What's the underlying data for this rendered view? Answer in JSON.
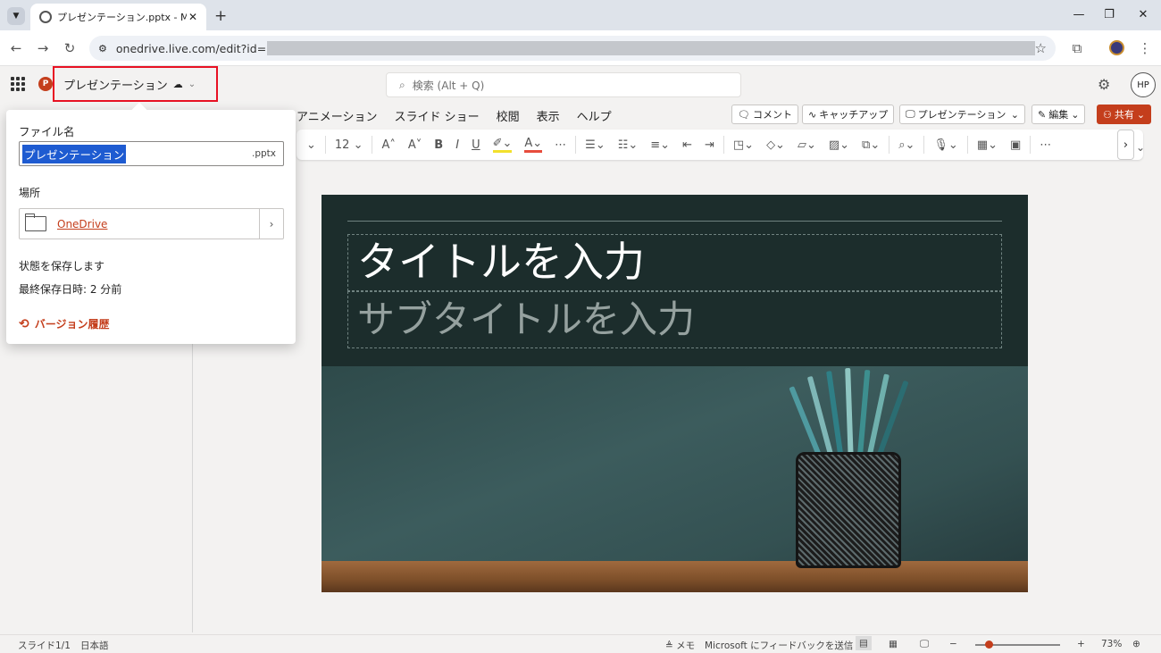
{
  "browser": {
    "tab_title": "プレゼンテーション.pptx - Microsoft",
    "url": "onedrive.live.com/edit?id="
  },
  "app": {
    "doc_title": "プレゼンテーション",
    "search_placeholder": "検索 (Alt + Q)",
    "avatar_initials": "HP"
  },
  "ribbon": {
    "tabs": [
      "アニメーション",
      "スライド ショー",
      "校閲",
      "表示",
      "ヘルプ"
    ],
    "buttons": {
      "comment": "コメント",
      "catchup": "キャッチアップ",
      "present": "プレゼンテーション",
      "edit": "編集",
      "share": "共有"
    },
    "font_size": "12"
  },
  "flyout": {
    "filename_label": "ファイル名",
    "filename_value": "プレゼンテーション",
    "extension": ".pptx",
    "location_label": "場所",
    "location_value": "OneDrive",
    "save_state": "状態を保存します",
    "last_saved": "最終保存日時: 2 分前",
    "version_history": "バージョン履歴"
  },
  "slide": {
    "title_placeholder": "タイトルを入力",
    "subtitle_placeholder": "サブタイトルを入力"
  },
  "status": {
    "slide_counter": "スライド1/1",
    "language": "日本語",
    "notes": "メモ",
    "feedback": "Microsoft にフィードバックを送信",
    "zoom": "73%"
  },
  "colors": {
    "accent": "#c43e1c",
    "highlight": "#e81123",
    "slide_bg": "#1c2d2c"
  }
}
